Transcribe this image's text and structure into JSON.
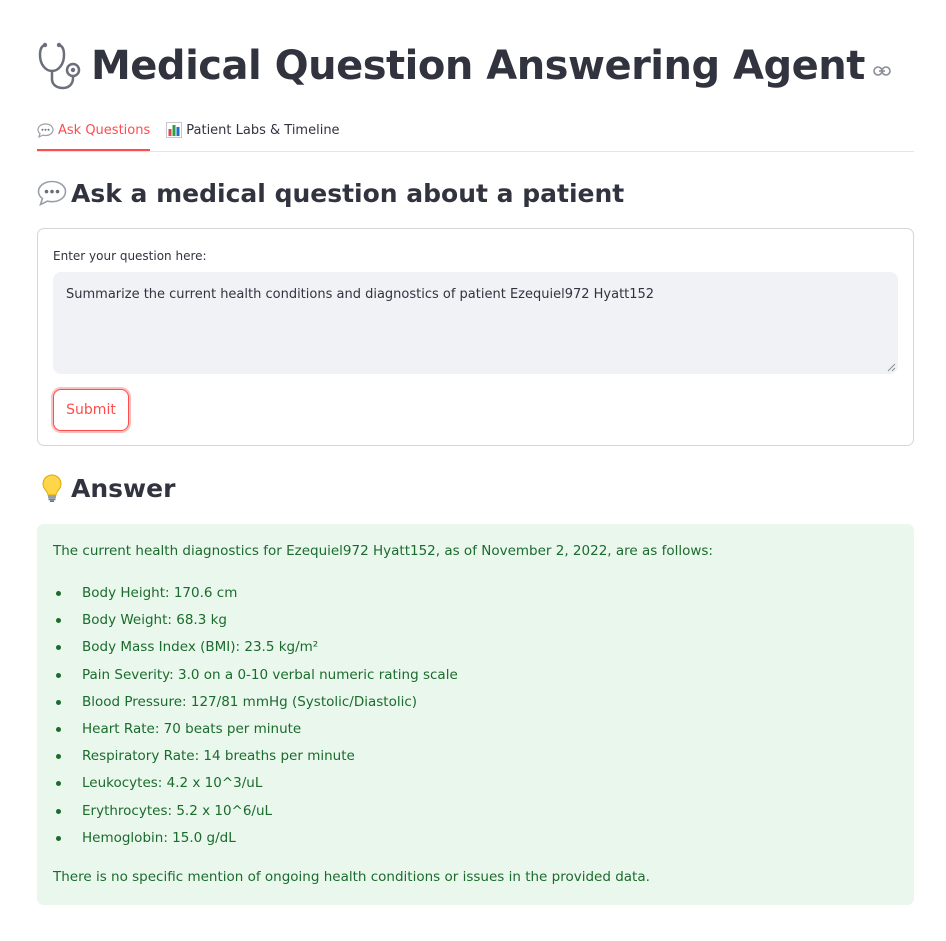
{
  "header": {
    "title": "Medical Question Answering Agent",
    "title_icon": "stethoscope-icon",
    "anchor_icon": "link-icon"
  },
  "tabs": [
    {
      "label": "Ask Questions",
      "icon": "speech-bubble-icon",
      "active": true
    },
    {
      "label": "Patient Labs & Timeline",
      "icon": "bar-chart-icon",
      "active": false
    }
  ],
  "colors": {
    "accent": "#ff4b4b",
    "text": "#31333f",
    "answer_bg": "#e9f7ec",
    "answer_text": "#1b6b2d",
    "input_bg": "#f0f2f6"
  },
  "ask_section": {
    "heading": "Ask a medical question about a patient",
    "icon": "speech-bubble-icon"
  },
  "form": {
    "field_label": "Enter your question here:",
    "question_value": "Summarize the current health conditions and diagnostics of patient Ezequiel972 Hyatt152",
    "submit_label": "Submit"
  },
  "answer_section": {
    "heading": "Answer",
    "icon": "light-bulb-icon",
    "intro": "The current health diagnostics for Ezequiel972 Hyatt152, as of November 2, 2022, are as follows:",
    "items": [
      "Body Height: 170.6 cm",
      "Body Weight: 68.3 kg",
      "Body Mass Index (BMI): 23.5 kg/m²",
      "Pain Severity: 3.0 on a 0-10 verbal numeric rating scale",
      "Blood Pressure: 127/81 mmHg (Systolic/Diastolic)",
      "Heart Rate: 70 beats per minute",
      "Respiratory Rate: 14 breaths per minute",
      "Leukocytes: 4.2 x 10^3/uL",
      "Erythrocytes: 5.2 x 10^6/uL",
      "Hemoglobin: 15.0 g/dL"
    ],
    "outro": "There is no specific mention of ongoing health conditions or issues in the provided data."
  }
}
